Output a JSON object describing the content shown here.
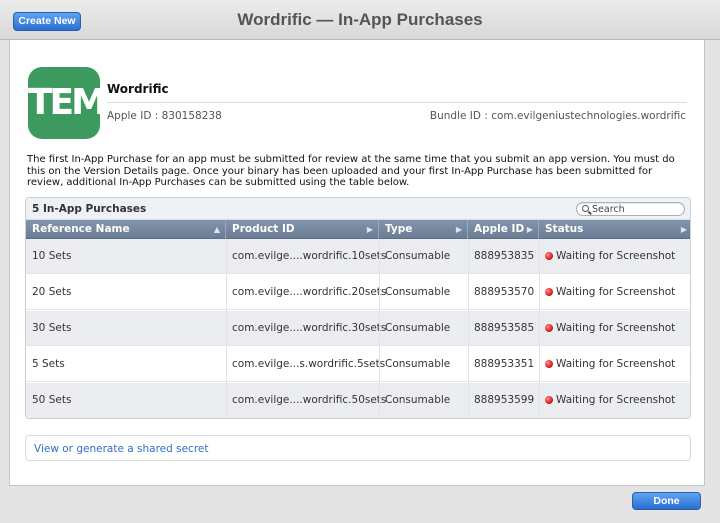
{
  "toolbar": {
    "create_new_label": "Create New",
    "title": "Wordrific — In-App Purchases"
  },
  "app": {
    "icon_text": "TEMP",
    "name": "Wordrific",
    "apple_id_text": "Apple ID : 830158238",
    "bundle_id_text": "Bundle ID : com.evilgeniustechnologies.wordrific",
    "icon_color": "#3c9a5f"
  },
  "description": "The first In-App Purchase for an app must be submitted for review at the same time that you submit an app version. You must do this on the Version Details page. Once your binary has been uploaded and your first In-App Purchase has been submitted for review, additional In-App Purchases can be submitted using the table below.",
  "table": {
    "title": "5 In-App Purchases",
    "search_placeholder": "Search",
    "columns": [
      "Reference Name",
      "Product ID",
      "Type",
      "Apple ID",
      "Status"
    ],
    "rows": [
      {
        "reference_name": "10 Sets",
        "product_id": "com.evilge....wordrific.10sets",
        "type": "Consumable",
        "apple_id": "888953835",
        "status": "Waiting for Screenshot"
      },
      {
        "reference_name": "20 Sets",
        "product_id": "com.evilge....wordrific.20sets",
        "type": "Consumable",
        "apple_id": "888953570",
        "status": "Waiting for Screenshot"
      },
      {
        "reference_name": "30 Sets",
        "product_id": "com.evilge....wordrific.30sets",
        "type": "Consumable",
        "apple_id": "888953585",
        "status": "Waiting for Screenshot"
      },
      {
        "reference_name": "5 Sets",
        "product_id": "com.evilge...s.wordrific.5sets",
        "type": "Consumable",
        "apple_id": "888953351",
        "status": "Waiting for Screenshot"
      },
      {
        "reference_name": "50 Sets",
        "product_id": "com.evilge....wordrific.50sets",
        "type": "Consumable",
        "apple_id": "888953599",
        "status": "Waiting for Screenshot"
      }
    ]
  },
  "shared_secret_link": "View or generate a shared secret",
  "done_label": "Done",
  "colors": {
    "accent_blue": "#2a6fd0",
    "status_red": "#d01010",
    "header_slate": "#6a7d96"
  }
}
